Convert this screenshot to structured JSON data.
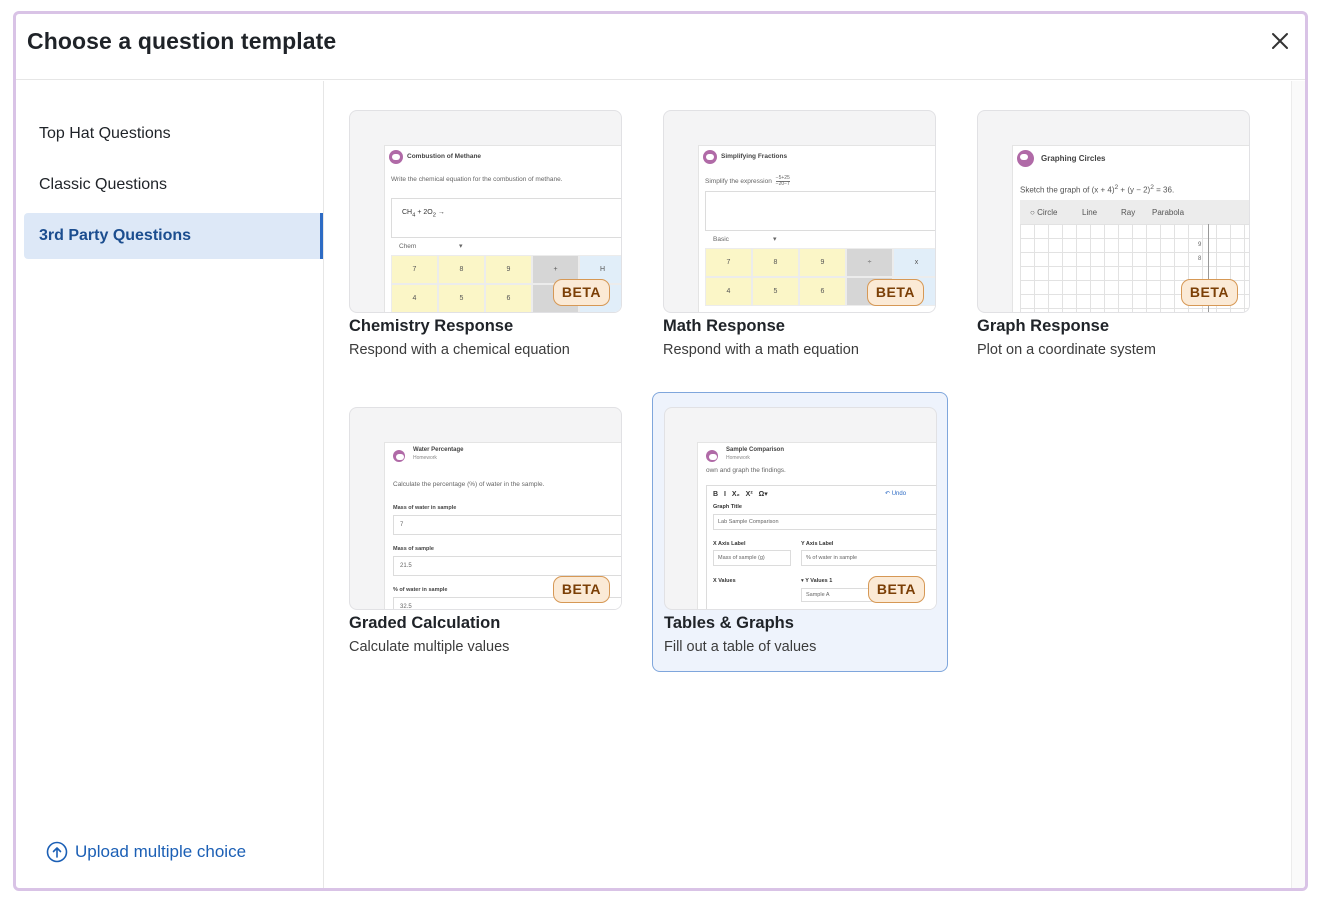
{
  "dialog": {
    "title": "Choose a question template",
    "close_icon": "close-icon"
  },
  "sidebar": {
    "items": [
      {
        "label": "Top Hat Questions"
      },
      {
        "label": "Classic Questions"
      },
      {
        "label": "3rd Party Questions"
      }
    ],
    "active_index": 2,
    "upload_label": "Upload multiple choice"
  },
  "badge": "BETA",
  "templates": [
    {
      "name": "Chemistry Response",
      "description": "Respond with a chemical equation",
      "preview": {
        "title": "Combustion of Methane",
        "prompt": "Write the chemical equation for the combustion of methane.",
        "input": "CH",
        "input_sub": "4",
        "input_mid": " + 2O",
        "input_sub2": "2",
        "input_end": " →",
        "dropdown": "Chem",
        "keys": [
          "7",
          "8",
          "9",
          "+",
          "H",
          "4",
          "5",
          "6",
          "×",
          ""
        ]
      }
    },
    {
      "name": "Math Response",
      "description": "Respond with a math equation",
      "preview": {
        "title": "Simplifying Fractions",
        "prompt": "Simplify the expression",
        "fraction_top": "−5+25",
        "fraction_bottom": "−20−7",
        "dropdown": "Basic",
        "keys": [
          "7",
          "8",
          "9",
          "÷",
          "x",
          "4",
          "5",
          "6",
          "×",
          ""
        ]
      }
    },
    {
      "name": "Graph Response",
      "description": "Plot on a coordinate system",
      "preview": {
        "title": "Graphing Circles",
        "prompt_start": "Sketch the graph of (x + 4)",
        "prompt_mid": " + (y − 2)",
        "prompt_end": " = 36.",
        "sup": "2",
        "tools": [
          "Circle",
          "Line",
          "Ray",
          "Parabola"
        ],
        "axis_labels": [
          "9",
          "8"
        ]
      }
    },
    {
      "name": "Graded Calculation",
      "description": "Calculate multiple values",
      "preview": {
        "title": "Water Percentage",
        "subtitle": "Homework",
        "prompt": "Calculate the percentage (%) of water in the sample.",
        "fields": [
          {
            "label": "Mass of water in sample",
            "value": "7"
          },
          {
            "label": "Mass of sample",
            "value": "21.5"
          },
          {
            "label": "% of water in sample",
            "value": "32.5"
          }
        ]
      }
    },
    {
      "name": "Tables & Graphs",
      "description": "Fill out a table of values",
      "preview": {
        "title": "Sample Comparison",
        "subtitle": "Homework",
        "prompt": "own and graph the findings.",
        "toolbar": [
          "B",
          "I",
          "X₂",
          "X²",
          "Ω▾"
        ],
        "undo": "↶ Undo",
        "graph_title_label": "Graph Title",
        "graph_title_value": "Lab Sample Comparison",
        "x_axis_label": "X Axis Label",
        "x_axis_value": "Mass of sample (g)",
        "y_axis_label": "Y Axis Label",
        "y_axis_value": "% of water in sample",
        "x_values": "X Values",
        "y_values": "Y Values 1",
        "y_sample": "Sample A"
      }
    }
  ],
  "selected_template_index": 4,
  "colors": {
    "accent": "#2d6bc4",
    "active_bg": "#dde8f7",
    "frame_border": "#d9c3e6",
    "badge_bg": "#fbead6",
    "badge_border": "#d69855",
    "badge_text": "#7b3f06"
  }
}
